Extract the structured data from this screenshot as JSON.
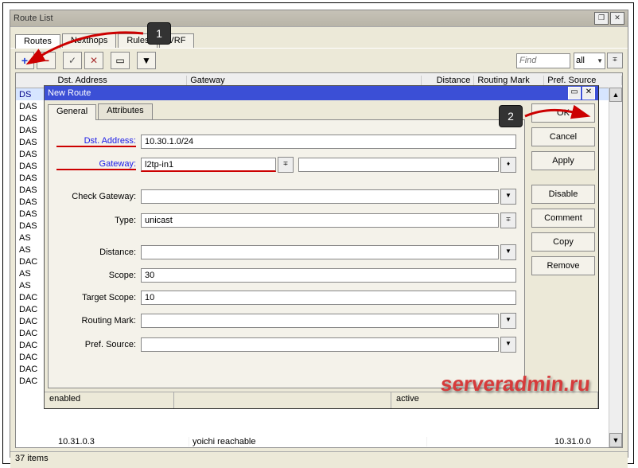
{
  "route_list": {
    "title": "Route List",
    "tabs": [
      "Routes",
      "Nexthops",
      "Rules",
      "VRF"
    ],
    "toolbar": {
      "find_placeholder": "Find",
      "all_label": "all"
    },
    "headers": {
      "flags": "",
      "dst": "Dst. Address",
      "gateway": "Gateway",
      "distance": "Distance",
      "routing_mark": "Routing Mark",
      "pref_source": "Pref. Source"
    },
    "rows": [
      {
        "flags": "DS"
      },
      {
        "flags": "DAS"
      },
      {
        "flags": "DAS"
      },
      {
        "flags": "DAS"
      },
      {
        "flags": "DAS"
      },
      {
        "flags": "DAS"
      },
      {
        "flags": "DAS"
      },
      {
        "flags": "DAS"
      },
      {
        "flags": "DAS"
      },
      {
        "flags": "DAS"
      },
      {
        "flags": "DAS"
      },
      {
        "flags": "DAS"
      },
      {
        "flags": "AS"
      },
      {
        "flags": "AS"
      },
      {
        "flags": "DAC"
      },
      {
        "flags": "AS"
      },
      {
        "flags": "AS"
      },
      {
        "flags": "DAC"
      },
      {
        "flags": "DAC"
      },
      {
        "flags": "DAC"
      },
      {
        "flags": "DAC"
      },
      {
        "flags": "DAC"
      },
      {
        "flags": "DAC"
      },
      {
        "flags": "DAC"
      },
      {
        "flags": "DAC"
      }
    ],
    "status": "37 items",
    "partial_row": {
      "dst": "10.31.0.3",
      "gw": "yoichi reachable",
      "ps": "10.31.0.0"
    }
  },
  "new_route": {
    "title": "New Route",
    "tabs": [
      "General",
      "Attributes"
    ],
    "labels": {
      "dst": "Dst. Address:",
      "gateway": "Gateway:",
      "check_gateway": "Check Gateway:",
      "type": "Type:",
      "distance": "Distance:",
      "scope": "Scope:",
      "target_scope": "Target Scope:",
      "routing_mark": "Routing Mark:",
      "pref_source": "Pref. Source:"
    },
    "values": {
      "dst": "10.30.1.0/24",
      "gateway": "l2tp-in1",
      "gateway_status": "",
      "check_gateway": "",
      "type": "unicast",
      "distance": "",
      "scope": "30",
      "target_scope": "10",
      "routing_mark": "",
      "pref_source": ""
    },
    "buttons": {
      "ok": "OK",
      "cancel": "Cancel",
      "apply": "Apply",
      "disable": "Disable",
      "comment": "Comment",
      "copy": "Copy",
      "remove": "Remove"
    },
    "status": {
      "enabled": "enabled",
      "active": "active"
    }
  },
  "annotations": {
    "badge1": "1",
    "badge2": "2",
    "watermark": "serveradmin.ru"
  }
}
